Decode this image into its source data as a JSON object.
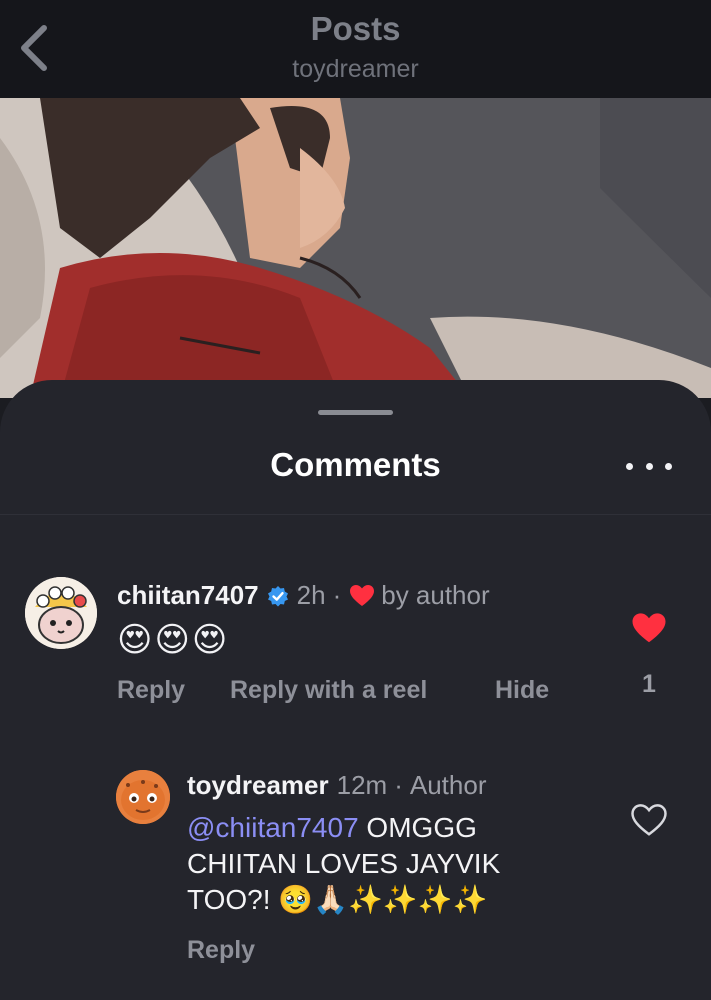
{
  "header": {
    "title": "Posts",
    "subtitle": "toydreamer"
  },
  "comments_sheet": {
    "title": "Comments"
  },
  "comment": {
    "username": "chiitan7407",
    "time": "2h",
    "separator": "·",
    "liked_by": "by author",
    "text_emojis": "😍😍😍",
    "actions": {
      "reply": "Reply",
      "reply_reel": "Reply with a reel",
      "hide": "Hide"
    },
    "like_count": "1",
    "colors": {
      "heart": "#ff3040",
      "verified": "#3797f0"
    }
  },
  "reply": {
    "username": "toydreamer",
    "time": "12m",
    "separator": "·",
    "role": "Author",
    "mention": "@chiitan7407",
    "text": " OMGGG CHIITAN LOVES JAYVIK TOO?! 🥹🙏🏻✨✨✨✨",
    "action_reply": "Reply"
  }
}
